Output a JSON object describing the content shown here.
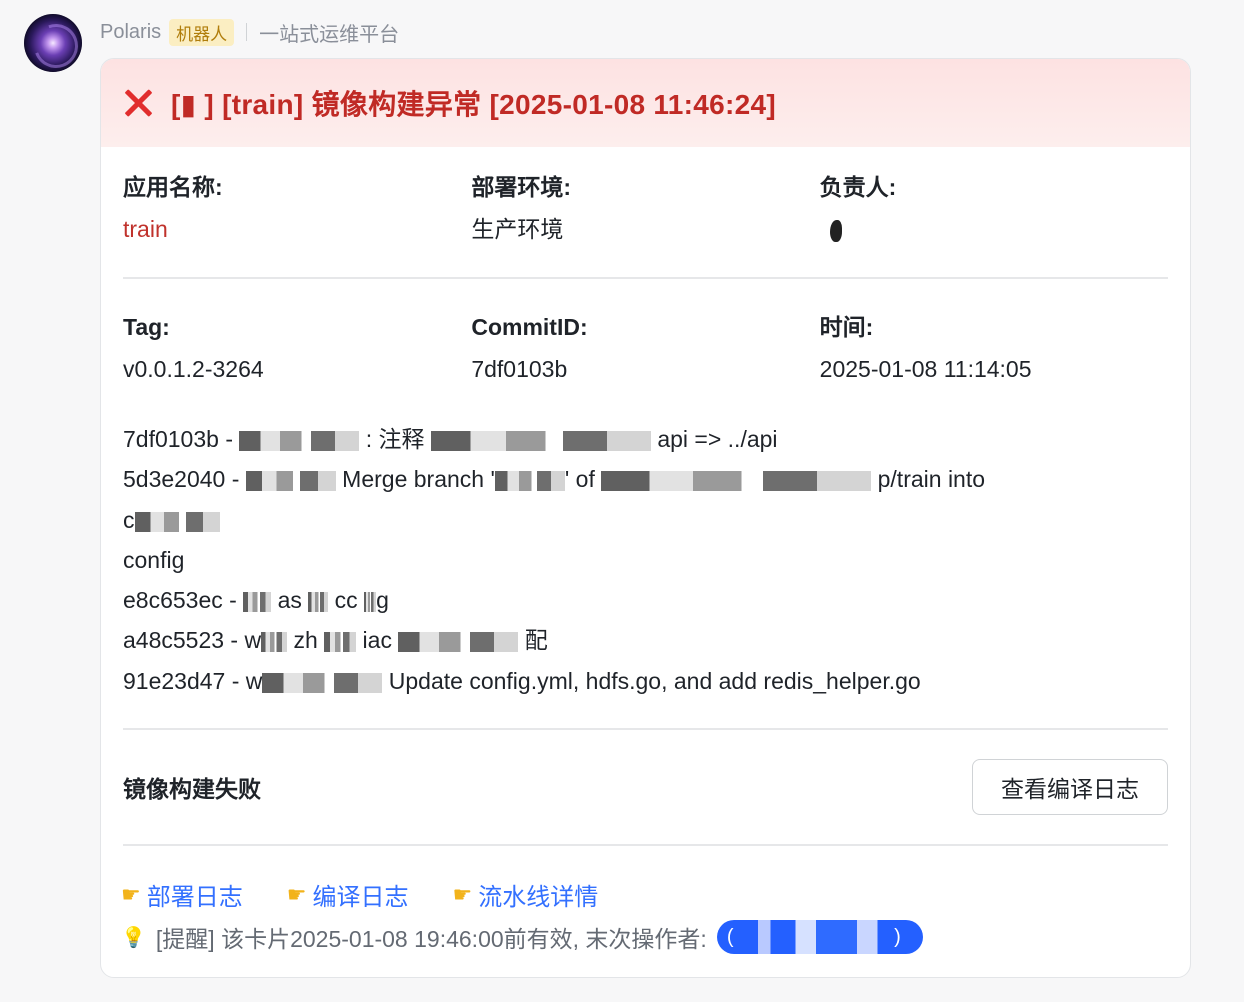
{
  "sender": {
    "name": "Polaris",
    "badge": "机器人",
    "subtitle": "一站式运维平台"
  },
  "card": {
    "title": "[▮  ] [train] 镜像构建异常 [2025-01-08 11:46:24]",
    "header_color": "#fde6e6",
    "status_icon": "close-icon",
    "fields_row1": [
      {
        "label": "应用名称:",
        "value": "train",
        "value_color": "#c0322c"
      },
      {
        "label": "部署环境:",
        "value": "生产环境"
      },
      {
        "label": "负责人:",
        "value": ""
      }
    ],
    "fields_row2": [
      {
        "label": "Tag:",
        "value": "v0.0.1.2-3264"
      },
      {
        "label": "CommitID:",
        "value": "7df0103b"
      },
      {
        "label": "时间:",
        "value": "2025-01-08 11:14:05"
      }
    ],
    "commits": [
      {
        "a": "7df0103b - ",
        "b": " : 注释 ",
        "c": " api => ../api"
      },
      {
        "a": "5d3e2040 - ",
        "b": " Merge branch '",
        "c": "' of ",
        "d": " p/train into"
      },
      {
        "a": "c",
        "b": ""
      },
      {
        "a": "config"
      },
      {
        "a": "e8c653ec - ",
        "b": " as ",
        "c": " cc ",
        "d": "g"
      },
      {
        "a": "a48c5523 - w",
        "b": " zh ",
        "c": " iac ",
        "d": " 配"
      },
      {
        "a": "91e23d47 - w",
        "b": " Update config.yml, hdfs.go, and add redis_helper.go"
      }
    ],
    "fail_label": "镜像构建失败",
    "view_log_button": "查看编译日志",
    "links": [
      "部署日志",
      "编译日志",
      "流水线详情"
    ],
    "reminder": "[提醒] 该卡片2025-01-08 19:46:00前有效, 末次操作者:",
    "operator": "(",
    "operator_close": ")"
  }
}
